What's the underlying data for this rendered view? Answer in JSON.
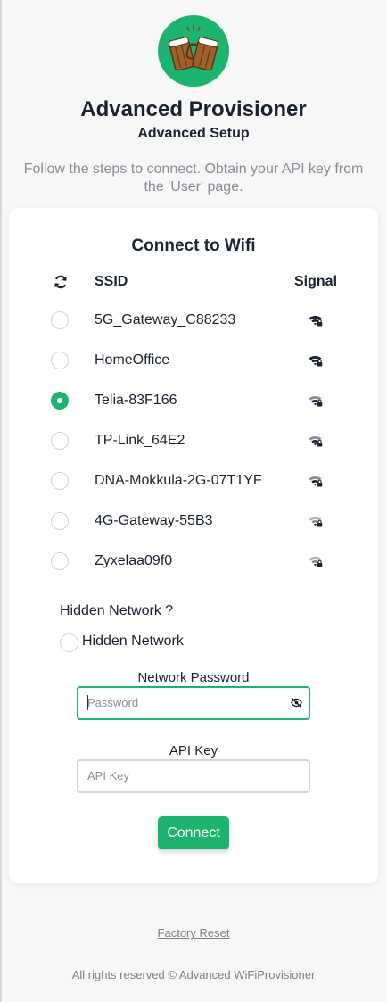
{
  "header": {
    "title": "Advanced Provisioner",
    "subtitle": "Advanced Setup",
    "description": "Follow the steps to connect. Obtain your API key from the 'User' page."
  },
  "wifi": {
    "title": "Connect to Wifi",
    "ssid_header": "SSID",
    "signal_header": "Signal",
    "networks": [
      {
        "ssid": "5G_Gateway_C88233",
        "selected": false,
        "signal": "strong"
      },
      {
        "ssid": "HomeOffice",
        "selected": false,
        "signal": "strong"
      },
      {
        "ssid": "Telia-83F166",
        "selected": true,
        "signal": "medium"
      },
      {
        "ssid": "TP-Link_64E2",
        "selected": false,
        "signal": "medium"
      },
      {
        "ssid": "DNA-Mokkula-2G-07T1YF",
        "selected": false,
        "signal": "medium"
      },
      {
        "ssid": "4G-Gateway-55B3",
        "selected": false,
        "signal": "weak"
      },
      {
        "ssid": "Zyxelaa09f0",
        "selected": false,
        "signal": "weak"
      }
    ]
  },
  "hidden": {
    "question": "Hidden Network ?",
    "label": "Hidden Network"
  },
  "password": {
    "label": "Network Password",
    "placeholder": "Password"
  },
  "api_key": {
    "label": "API Key",
    "placeholder": "API Key"
  },
  "connect_label": "Connect",
  "factory_reset": "Factory Reset",
  "footer": "All rights reserved © Advanced WiFiProvisioner",
  "colors": {
    "accent": "#1db46f",
    "text": "#1b2330",
    "muted": "#878c95"
  },
  "icons": {
    "refresh": "refresh-icon",
    "signal": "wifi-lock-icon",
    "password_toggle": "eye-off-icon"
  }
}
